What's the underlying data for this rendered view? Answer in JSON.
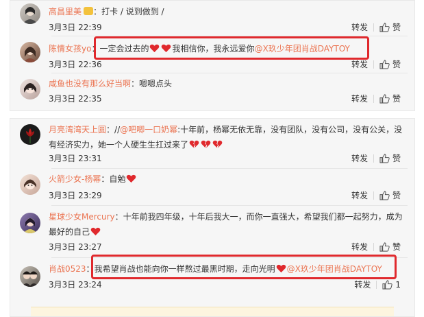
{
  "top_comments": [
    {
      "user": "高昌里美",
      "sep": "：",
      "text": "打卡 / 说到做到 /",
      "time": "3月3日 22:39",
      "repost": "转发",
      "like": "赞"
    },
    {
      "user": "陈情女孩yo",
      "sep": "：",
      "text_before": "一定会过去的",
      "text_after": "我相信你，我永远爱你",
      "mention": "@X玖少年团肖战DAYTOY",
      "time": "3月3日 22:36",
      "repost": "转发",
      "like": "赞"
    },
    {
      "user": "咸鱼也没有那么好当啊",
      "sep": "：",
      "text": "嗯嗯点头",
      "time": "3月3日 22:35",
      "repost": "转发",
      "like": "赞"
    }
  ],
  "bottom_comments": [
    {
      "user": "月亮湾湾天上圆",
      "sep": "：",
      "prefix": "//",
      "mention": "@吧唧一口奶幂",
      "text": ":十年前，杨幂无依无靠，没有团队，没有公司，没有公关，没有经济实力，她一个人硬生生扛过来了",
      "time": "3月3日 23:31",
      "repost": "转发",
      "like": "赞"
    },
    {
      "user": "火箭少女-杨幂",
      "sep": "：",
      "text": "自勉",
      "time": "3月3日 23:29",
      "repost": "转发",
      "like": "赞"
    },
    {
      "user": "星球少女Mercury",
      "sep": "：",
      "text": "十年前我四年级，十年后我大一，而你一直强大，希望我们都一起努力，成为最好的自己",
      "time": "3月3日 23:27",
      "repost": "转发",
      "like": "赞"
    },
    {
      "user": "肖战0523",
      "sep": "：",
      "text": "我希望肖战也能向你一样熬过最黑时期，走向光明",
      "mention": "@X玖少年团肖战DAYTOY",
      "time": "3月3日 23:24",
      "repost": "转发",
      "like_count": "1"
    }
  ],
  "colors": {
    "username": "#eb7350",
    "heart": "#e0292d",
    "highlight_box": "#e0292d"
  }
}
